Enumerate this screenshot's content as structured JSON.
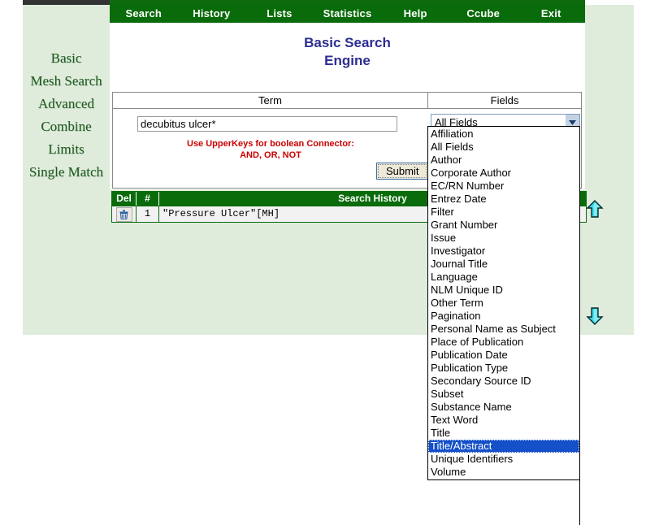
{
  "nav": {
    "items": [
      {
        "label": "Search"
      },
      {
        "label": "History"
      },
      {
        "label": "Lists"
      },
      {
        "label": "Statistics"
      },
      {
        "label": "Help"
      },
      {
        "label": "Ccube"
      },
      {
        "label": "Exit"
      }
    ]
  },
  "sidebar": {
    "items": [
      {
        "label": "Basic"
      },
      {
        "label": "Mesh Search"
      },
      {
        "label": "Advanced"
      },
      {
        "label": "Combine"
      },
      {
        "label": "Limits"
      },
      {
        "label": "Single Match"
      }
    ]
  },
  "page": {
    "title_line1": "Basic Search",
    "title_line2": "Engine"
  },
  "form": {
    "header_term": "Term",
    "header_fields": "Fields",
    "term_value": "decubitus ulcer*",
    "term_placeholder": "",
    "warning_line1": "Use UpperKeys for boolean Connector:",
    "warning_line2": "AND, OR, NOT",
    "submit_label": "Submit",
    "selected_field": "All Fields",
    "highlighted_option": "Title/Abstract",
    "field_options": [
      "Affiliation",
      "All Fields",
      "Author",
      "Corporate Author",
      "EC/RN Number",
      "Entrez Date",
      "Filter",
      "Grant Number",
      "Issue",
      "Investigator",
      "Journal Title",
      "Language",
      "NLM Unique ID",
      "Other Term",
      "Pagination",
      "Personal Name as Subject",
      "Place of Publication",
      "Publication Date",
      "Publication Type",
      "Secondary Source ID",
      "Subset",
      "Substance Name",
      "Text Word",
      "Title",
      "Title/Abstract",
      "Unique Identifiers",
      "Volume"
    ]
  },
  "history": {
    "columns": {
      "del": "Del",
      "num": "#",
      "query": "Search History"
    },
    "rows": [
      {
        "num": "1",
        "query": "\"Pressure Ulcer\"[MH]",
        "delete_icon": "trash-icon"
      }
    ]
  },
  "icons": {
    "arrow_up": "arrow-up-icon",
    "arrow_down": "arrow-down-icon",
    "dropdown_arrow": "chevron-down-icon"
  },
  "colors": {
    "nav_green": "#0a6b0a",
    "panel_green": "#dfecdc",
    "title_blue": "#2d2d8f",
    "warning_red": "#cc0000",
    "highlight_blue": "#1450c8",
    "arrow_cyan": "#35d6e0",
    "sidebar_text": "#1f5c1f"
  }
}
